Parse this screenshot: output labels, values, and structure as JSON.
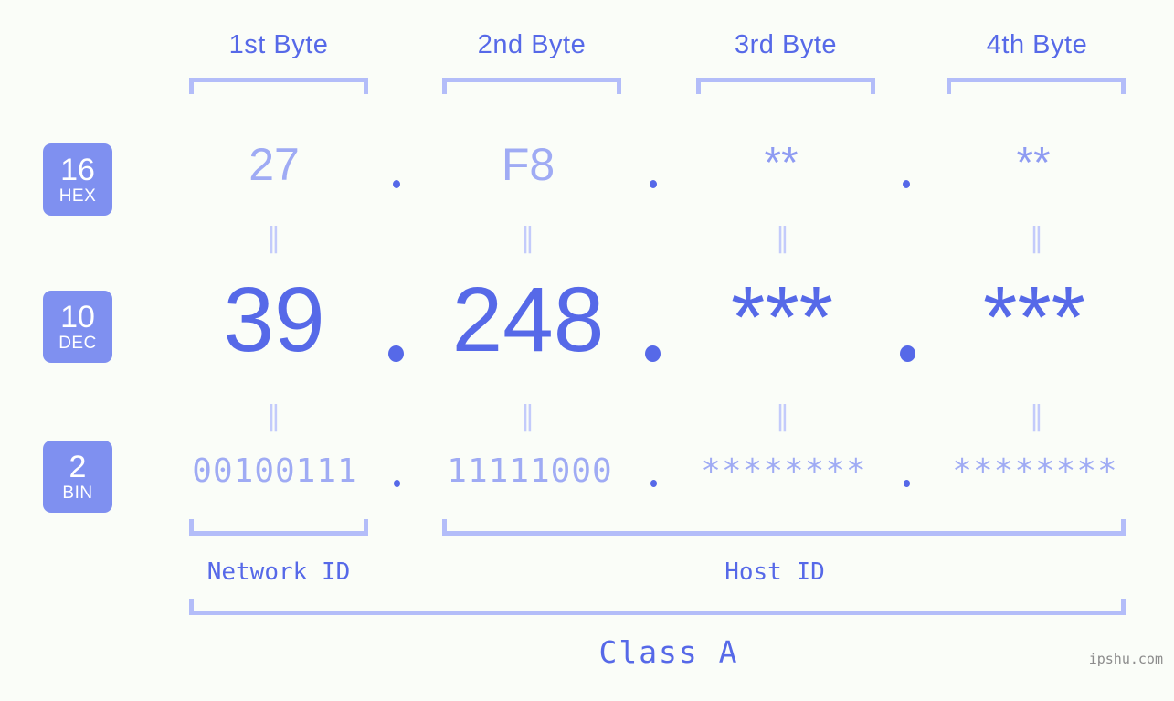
{
  "colors": {
    "background": "#fafdf8",
    "accent_strong": "#5669e8",
    "accent_light": "#9fabf4",
    "bracket": "#b3bdf9",
    "badge_bg": "#7f90f0",
    "connector": "#c3cbfb",
    "watermark": "#8c8c8c"
  },
  "headers": [
    {
      "label": "1st Byte"
    },
    {
      "label": "2nd Byte"
    },
    {
      "label": "3rd Byte"
    },
    {
      "label": "4th Byte"
    }
  ],
  "bases": [
    {
      "num": "16",
      "unit": "HEX"
    },
    {
      "num": "10",
      "unit": "DEC"
    },
    {
      "num": "2",
      "unit": "BIN"
    }
  ],
  "rows": {
    "hex": {
      "b1": "27",
      "b2": "F8",
      "b3": "**",
      "b4": "**"
    },
    "dec": {
      "b1": "39",
      "b2": "248",
      "b3": "***",
      "b4": "***"
    },
    "bin": {
      "b1": "00100111",
      "b2": "11111000",
      "b3": "********",
      "b4": "********"
    }
  },
  "separator": ".",
  "connector": "‖",
  "footer": {
    "network_id": "Network ID",
    "host_id": "Host ID",
    "class": "Class A"
  },
  "watermark": "ipshu.com"
}
